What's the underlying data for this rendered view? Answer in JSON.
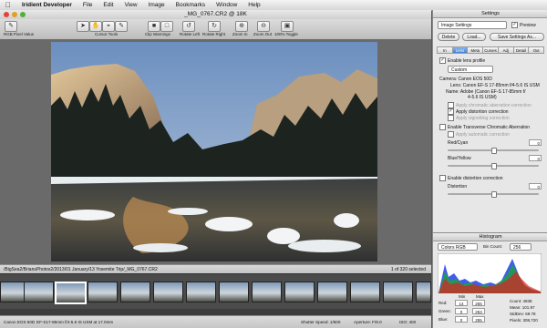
{
  "menubar": {
    "apple": "",
    "app_name": "Iridient Developer",
    "items": [
      "File",
      "Edit",
      "View",
      "Image",
      "Bookmarks",
      "Window",
      "Help"
    ],
    "right": []
  },
  "window": {
    "title": "_MG_0767.CR2 @ 18K"
  },
  "toolbar": {
    "labels": {
      "rgb_pixel_value": "RGB Pixel Value",
      "cursor_tools": "Cursor Tools",
      "clip_warnings": "Clip Warnings",
      "rotate_left": "Rotate Left",
      "rotate_right": "Rotate Right",
      "zoom_in": "Zoom In",
      "zoom_out": "Zoom Out",
      "toggle_100": "100% Toggle"
    }
  },
  "pathbar": {
    "path": "/BigSea2/BriansPhotos2/2013/01 January/13 Yosemite Trip/_MG_0767.CR2",
    "count": "1 of 320 selected"
  },
  "statusbar": {
    "camera": "Canon EOS 50D",
    "lens": "EF-S17-85mm f/4-5.6 IS USM at 17.0mm",
    "shutter": "Shutter Speed: 1/500",
    "aperture": "Aperture: F/8.0",
    "iso": "ISO: 400"
  },
  "settings": {
    "title": "Settings",
    "preset": "Image Settings",
    "preview_label": "Preview",
    "preview_checked": true,
    "delete_label": "Delete",
    "load_label": "Load...",
    "save_label": "Save Settings As...",
    "tabs": [
      "In",
      "Lens",
      "Meta",
      "Curves",
      "Adj",
      "Detail",
      "Out"
    ],
    "active_tab": 1,
    "enable_lens_profile": "Enable lens profile",
    "profile": "Custom",
    "camera": "Camera: Canon EOS 50D",
    "lens": "Lens: Canon EF-S 17-85mm f/4-5.6 IS USM",
    "name_line1": "Name: Adobe (Canon EF-S 17-85mm f/",
    "name_line2": "4-5.6 IS USM)",
    "apply_chromatic": "Apply chromatic aberration correction",
    "apply_distortion": "Apply distortion correction",
    "apply_vignetting": "Apply vignetting correction",
    "enable_transverse": "Enable Transverse Chromatic Aberration",
    "apply_automatic": "Apply automatic correction",
    "red_cyan": "Red/Cyan",
    "red_cyan_value": "0",
    "blue_yellow": "Blue/Yellow",
    "blue_yellow_value": "0",
    "enable_distortion": "Enable distortion correction",
    "distortion": "Distortion",
    "distortion_value": "0"
  },
  "histogram": {
    "title": "Histogram",
    "mode": "Colors RGB",
    "bin_count_label": "Bin Count:",
    "bin_count": "256",
    "min_label": "Min",
    "max_label": "Max",
    "rows": [
      {
        "label": "Red:",
        "min": "14",
        "max": "255"
      },
      {
        "label": "Green:",
        "min": "0",
        "max": "253"
      },
      {
        "label": "Blue:",
        "min": "0",
        "max": "255"
      }
    ],
    "stats": {
      "count": "Count: 4938",
      "mean": "Mean: 101.97",
      "stddev": "StdDev: 69.78",
      "pixels": "Pixels: 308,720"
    }
  },
  "colors": {
    "accent": "#3f7fd6",
    "close": "#e0443e",
    "minimize": "#dea123",
    "zoom": "#4fb13b"
  }
}
